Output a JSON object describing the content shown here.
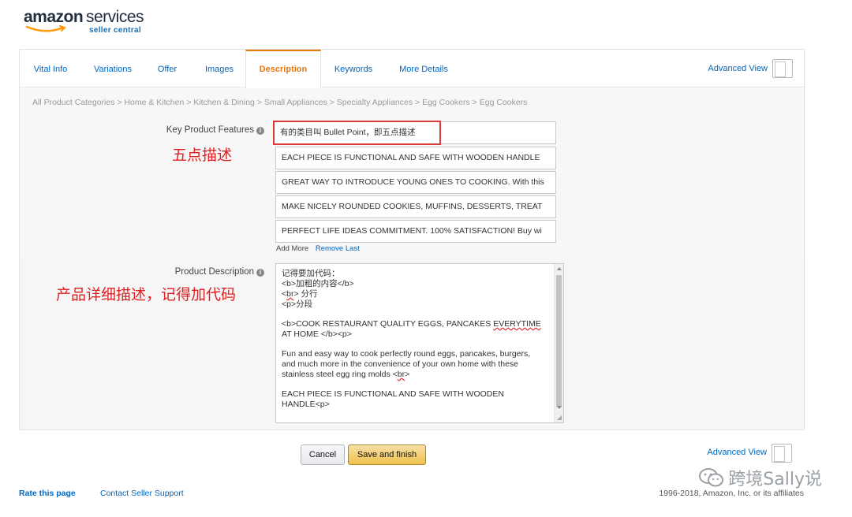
{
  "brand": {
    "amazon": "amazon",
    "services": "services",
    "sub": "seller central",
    "accent": "#e47911"
  },
  "tabs": [
    {
      "label": "Vital Info"
    },
    {
      "label": "Variations"
    },
    {
      "label": "Offer"
    },
    {
      "label": "Images"
    },
    {
      "label": "Description",
      "active": true
    },
    {
      "label": "Keywords"
    },
    {
      "label": "More Details"
    }
  ],
  "advanced_view_label": "Advanced View",
  "breadcrumb": "All Product Categories > Home & Kitchen > Kitchen & Dining > Small Appliances > Specialty Appliances > Egg Cookers > Egg Cookers",
  "key_features": {
    "label": "Key Product Features",
    "info_icon": "i",
    "annotation": "五点描述",
    "bullets": [
      "有的类目叫 Bullet Point，即五点描述",
      "EACH PIECE IS FUNCTIONAL AND SAFE WITH WOODEN HANDLE",
      "GREAT WAY TO INTRODUCE YOUNG ONES TO COOKING. With this",
      "MAKE NICELY ROUNDED COOKIES, MUFFINS, DESSERTS, TREAT",
      "PERFECT LIFE IDEAS COMMITMENT. 100% SATISFACTION! Buy wi"
    ],
    "add_more": "Add More",
    "remove_last": "Remove Last"
  },
  "description": {
    "label": "Product Description",
    "info_icon": "i",
    "annotation": "产品详细描述，记得加代码",
    "lines": {
      "l1": "记得要加代码：",
      "l2": "<b>加粗的内容</b>",
      "l3a": "<",
      "l3b": "br",
      "l3c": "> 分行",
      "l4": "<p>分段",
      "l5a": "<b>COOK RESTAURANT QUALITY EGGS, PANCAKES ",
      "l5b": "EVERYTIME",
      "l6": "AT HOME </b><p>",
      "l7": "Fun and easy way to cook perfectly round eggs, pancakes, burgers,",
      "l8": "and much more in the convenience of your own home with these",
      "l9a": "stainless steel egg ring molds <",
      "l9b": "br",
      "l9c": ">",
      "l10": "EACH PIECE IS FUNCTIONAL AND SAFE WITH WOODEN",
      "l11": "HANDLE<p>"
    }
  },
  "buttons": {
    "cancel": "Cancel",
    "save": "Save and finish"
  },
  "footer": {
    "rate": "Rate this page",
    "contact": "Contact Seller Support",
    "copyright": "1996-2018, Amazon, Inc. or its affiliates"
  },
  "watermark": {
    "text": "跨境Sally说",
    "icon": "wechat-icon"
  }
}
